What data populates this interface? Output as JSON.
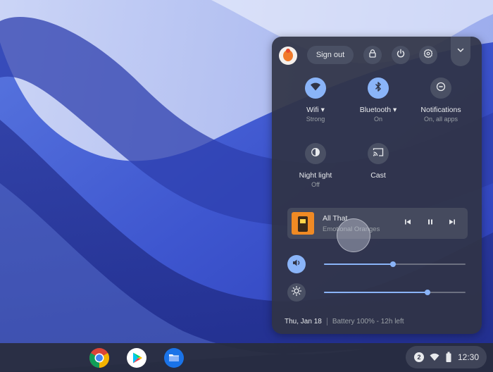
{
  "colors": {
    "accent": "#8ab4f8",
    "panel_bg": "#303446",
    "button_bg": "#4a5064",
    "text_primary": "#e8eaed",
    "text_secondary": "#9aa0a6"
  },
  "quick_settings": {
    "header": {
      "avatar_icon": "user-avatar",
      "sign_out_label": "Sign out",
      "lock_icon": "lock-icon",
      "power_icon": "power-icon",
      "settings_icon": "gear-icon",
      "collapse_icon": "chevron-down-icon"
    },
    "tiles": [
      {
        "label": "Wifi",
        "sub": "Strong",
        "icon": "wifi-icon",
        "state": "on",
        "has_menu": true
      },
      {
        "label": "Bluetooth",
        "sub": "On",
        "icon": "bluetooth-icon",
        "state": "on",
        "has_menu": true
      },
      {
        "label": "Notifications",
        "sub": "On, all apps",
        "icon": "do-not-disturb-icon",
        "state": "off",
        "has_menu": false
      },
      {
        "label": "Night light",
        "sub": "Off",
        "icon": "night-light-icon",
        "state": "off",
        "has_menu": false
      },
      {
        "label": "Cast",
        "sub": "",
        "icon": "cast-icon",
        "state": "off",
        "has_menu": false
      }
    ],
    "media": {
      "title": "All That",
      "artist": "Emotional Oranges",
      "prev_icon": "skip-previous-icon",
      "pause_icon": "pause-icon",
      "next_icon": "skip-next-icon"
    },
    "volume": {
      "icon": "volume-icon",
      "level": 0.49
    },
    "brightness": {
      "icon": "brightness-icon",
      "level": 0.73
    },
    "footer": {
      "date": "Thu, Jan 18",
      "battery": "Battery 100% - 12h left"
    }
  },
  "shelf": {
    "apps": [
      {
        "name": "Chrome",
        "icon": "chrome-icon"
      },
      {
        "name": "Play Store",
        "icon": "play-store-icon"
      },
      {
        "name": "Files",
        "icon": "files-icon"
      }
    ],
    "status": {
      "notification_count": "2",
      "wifi_icon": "wifi-icon",
      "battery_icon": "battery-icon",
      "time": "12:30"
    }
  }
}
